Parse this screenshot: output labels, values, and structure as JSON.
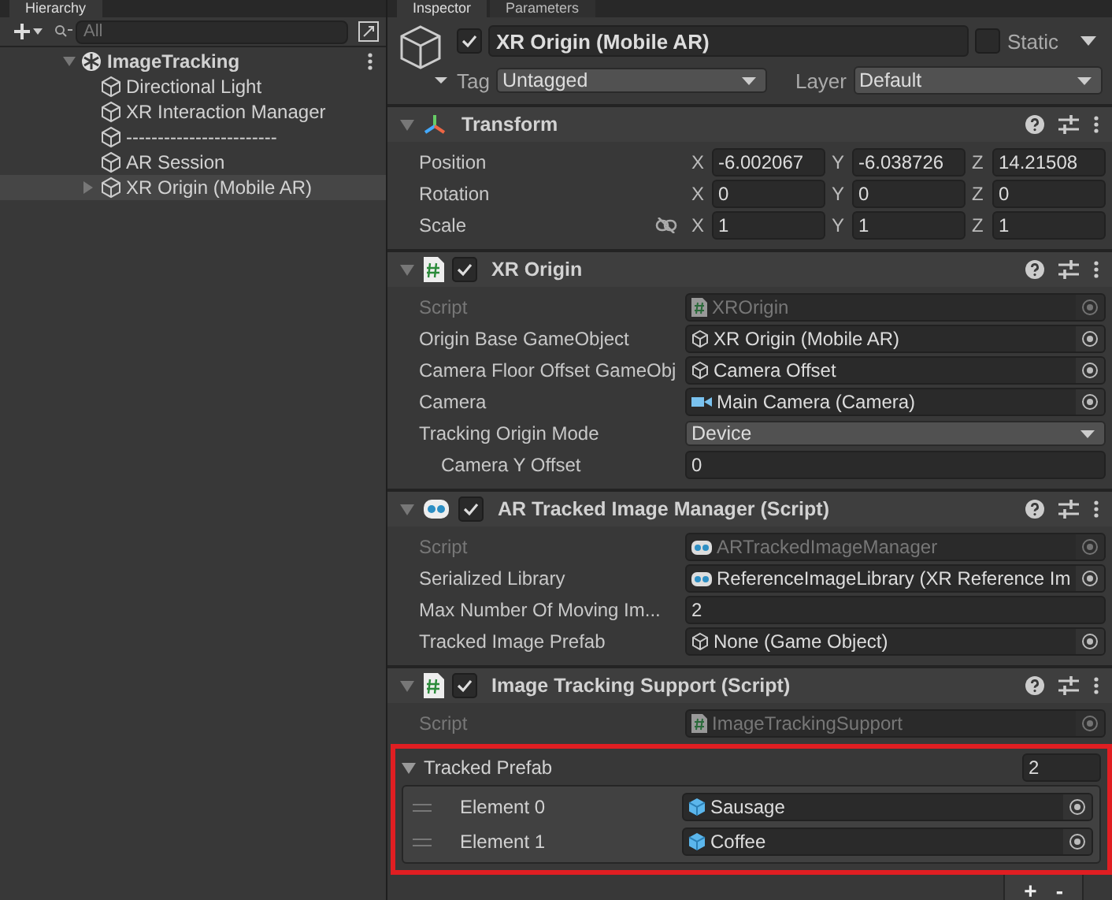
{
  "hierarchy": {
    "tab": "Hierarchy",
    "search": {
      "placeholder": "All"
    },
    "scene": {
      "name": "ImageTracking",
      "expanded": true,
      "children": [
        {
          "name": "Directional Light",
          "selected": false,
          "collapsed": false
        },
        {
          "name": "XR Interaction Manager",
          "selected": false,
          "collapsed": false
        },
        {
          "name": "------------------------",
          "selected": false,
          "collapsed": false
        },
        {
          "name": "AR Session",
          "selected": false,
          "collapsed": false
        },
        {
          "name": "XR Origin (Mobile AR)",
          "selected": true,
          "collapsed": true
        }
      ]
    }
  },
  "inspector": {
    "tabs": [
      {
        "label": "Inspector",
        "selected": true
      },
      {
        "label": "Parameters",
        "selected": false
      }
    ],
    "object": {
      "active": true,
      "name": "XR Origin (Mobile AR)",
      "static": false,
      "static_label": "Static",
      "tag_label": "Tag",
      "tag": "Untagged",
      "layer_label": "Layer",
      "layer": "Default"
    },
    "components": [
      {
        "kind": "transform",
        "title": "Transform",
        "expanded": true,
        "rows": [
          {
            "kind": "vector",
            "label": "Position",
            "values": [
              {
                "axis": "X",
                "value": "-6.002067"
              },
              {
                "axis": "Y",
                "value": "-6.038726"
              },
              {
                "axis": "Z",
                "value": "14.21508"
              }
            ]
          },
          {
            "kind": "vector",
            "label": "Rotation",
            "values": [
              {
                "axis": "X",
                "value": "0"
              },
              {
                "axis": "Y",
                "value": "0"
              },
              {
                "axis": "Z",
                "value": "0"
              }
            ]
          },
          {
            "kind": "vector",
            "label": "Scale",
            "constrained": false,
            "values": [
              {
                "axis": "X",
                "value": "1"
              },
              {
                "axis": "Y",
                "value": "1"
              },
              {
                "axis": "Z",
                "value": "1"
              }
            ]
          }
        ]
      },
      {
        "kind": "script",
        "title": "XR Origin",
        "enabled": true,
        "expanded": true,
        "rows": [
          {
            "kind": "scriptref",
            "label": "Script",
            "value": "XROrigin",
            "disabled": true
          },
          {
            "kind": "objectref",
            "label": "Origin Base GameObject",
            "value": "XR Origin (Mobile AR)",
            "disabled": false
          },
          {
            "kind": "objectref",
            "label": "Camera Floor Offset GameObj",
            "value": "Camera Offset",
            "disabled": false
          },
          {
            "kind": "cameraref",
            "label": "Camera",
            "value": "Main Camera (Camera)",
            "disabled": false
          },
          {
            "kind": "dropdown",
            "label": "Tracking Origin Mode",
            "value": "Device",
            "children": [
              {
                "kind": "number",
                "label": "Camera Y Offset",
                "value": "0"
              }
            ]
          }
        ]
      },
      {
        "kind": "arscript",
        "title": "AR Tracked Image Manager (Script)",
        "enabled": true,
        "expanded": true,
        "rows": [
          {
            "kind": "arref",
            "label": "Script",
            "value": "ARTrackedImageManager",
            "disabled": true
          },
          {
            "kind": "arref",
            "label": "Serialized Library",
            "value": "ReferenceImageLibrary (XR Reference Im",
            "disabled": false
          },
          {
            "kind": "number",
            "label": "Max Number Of Moving Im...",
            "value": "2"
          },
          {
            "kind": "objectref",
            "label": "Tracked Image Prefab",
            "value": "None (Game Object)",
            "disabled": false
          }
        ]
      },
      {
        "kind": "script",
        "title": "Image Tracking Support (Script)",
        "enabled": true,
        "expanded": true,
        "rows": [
          {
            "kind": "scriptref",
            "label": "Script",
            "value": "ImageTrackingSupport",
            "disabled": true
          },
          {
            "kind": "list",
            "label": "Tracked Prefab",
            "count": "2",
            "expanded": true,
            "highlighted": true,
            "elements": [
              {
                "label": "Element 0",
                "value": "Sausage"
              },
              {
                "label": "Element 1",
                "value": "Coffee"
              }
            ],
            "add": "+",
            "remove": "-"
          }
        ]
      }
    ]
  }
}
